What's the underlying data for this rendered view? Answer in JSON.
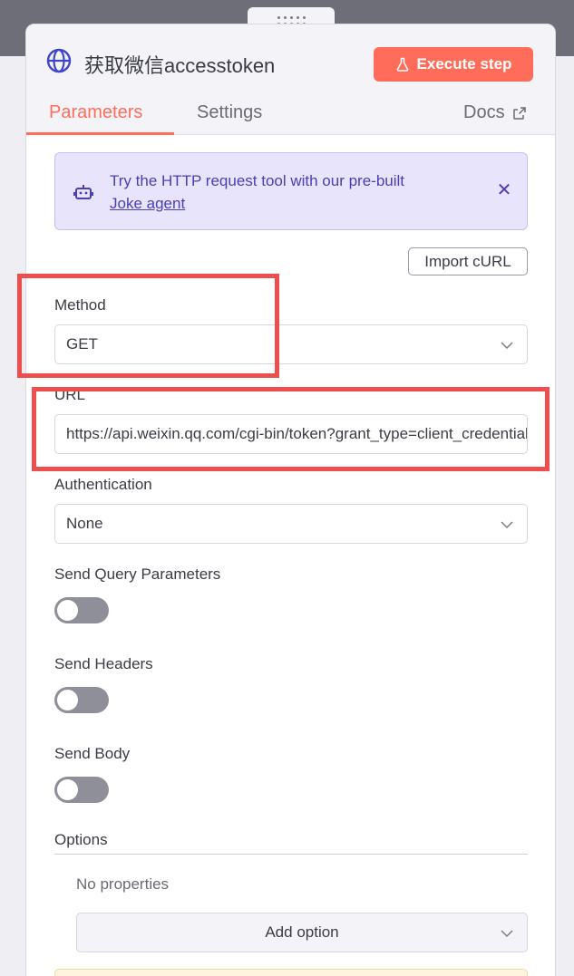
{
  "node": {
    "title": "获取微信accesstoken",
    "execute_label": "Execute step"
  },
  "tabs": {
    "parameters": "Parameters",
    "settings": "Settings",
    "docs": "Docs"
  },
  "callout": {
    "text": "Try the HTTP request tool with our pre-built",
    "link": "Joke agent"
  },
  "import_curl_label": "Import cURL",
  "method": {
    "label": "Method",
    "value": "GET"
  },
  "url": {
    "label": "URL",
    "value": "https://api.weixin.qq.com/cgi-bin/token?grant_type=client_credential"
  },
  "authentication": {
    "label": "Authentication",
    "value": "None"
  },
  "send_query": {
    "label": "Send Query Parameters",
    "enabled": false
  },
  "send_headers": {
    "label": "Send Headers",
    "enabled": false
  },
  "send_body": {
    "label": "Send Body",
    "enabled": false
  },
  "options": {
    "label": "Options",
    "empty_text": "No properties",
    "add_label": "Add option"
  },
  "colors": {
    "accent": "#ff6d5a",
    "callout_text": "#4b3fb8",
    "highlight": "#ef4e4e"
  }
}
